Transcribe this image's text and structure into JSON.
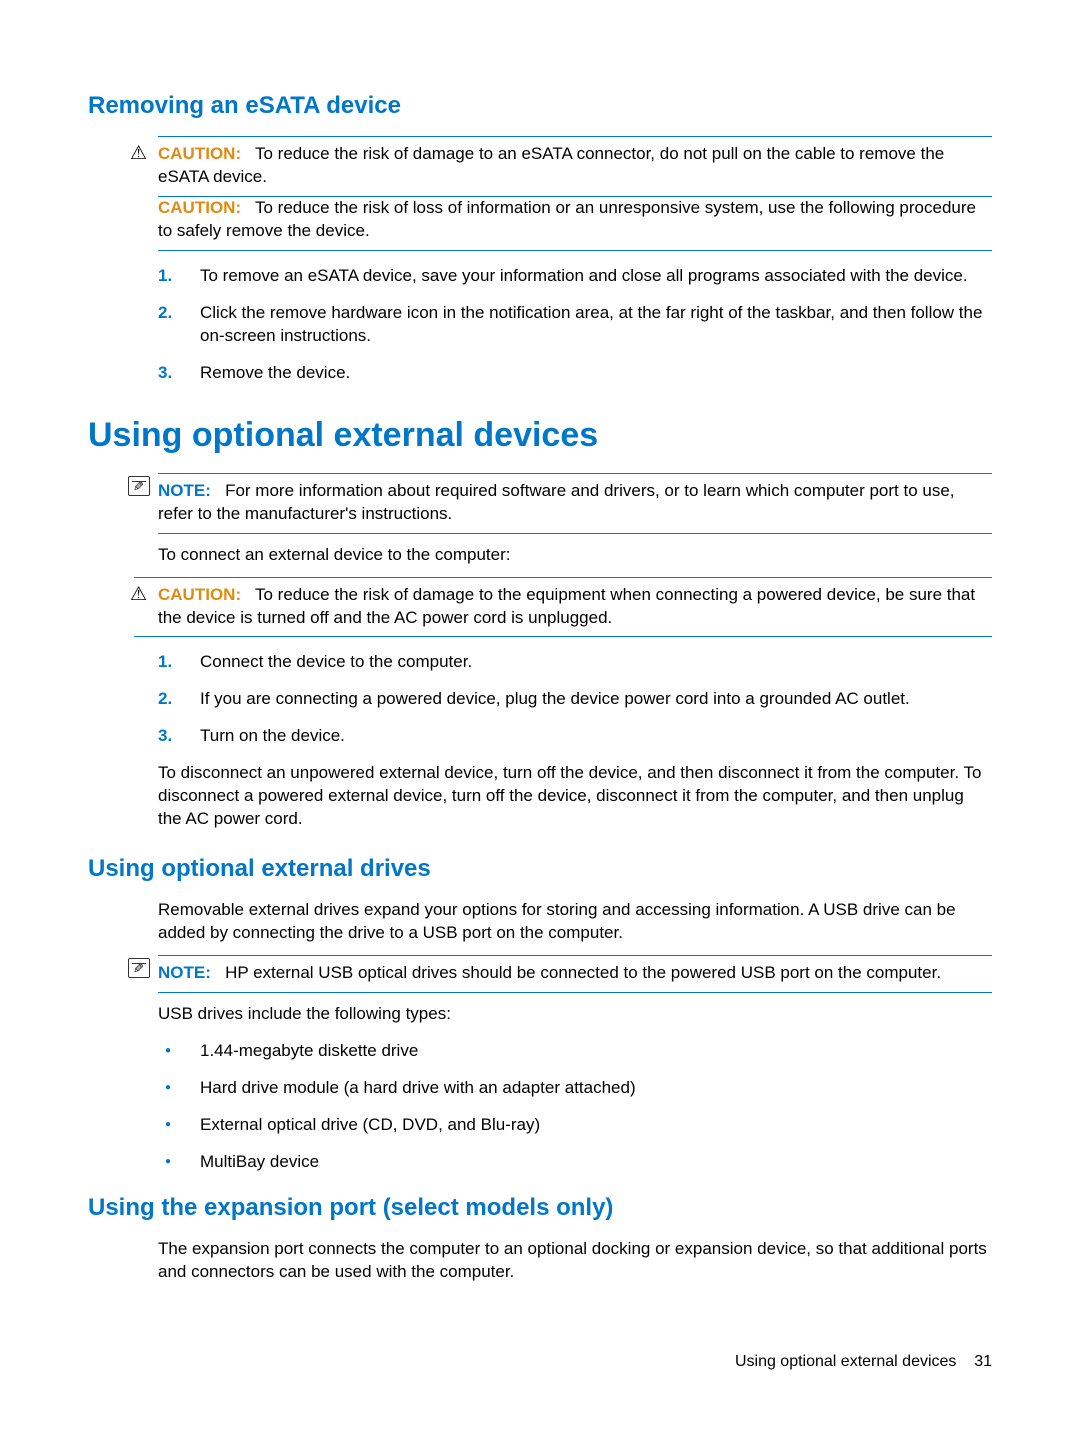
{
  "section1": {
    "title": "Removing an eSATA device",
    "caution1_label": "CAUTION:",
    "caution1_text": "To reduce the risk of damage to an eSATA connector, do not pull on the cable to remove the eSATA device.",
    "caution2_label": "CAUTION:",
    "caution2_text": "To reduce the risk of loss of information or an unresponsive system, use the following procedure to safely remove the device.",
    "steps": [
      "To remove an eSATA device, save your information and close all programs associated with the device.",
      "Click the remove hardware icon in the notification area, at the far right of the taskbar, and then follow the on-screen instructions.",
      "Remove the device."
    ]
  },
  "section2": {
    "title": "Using optional external devices",
    "note1_label": "NOTE:",
    "note1_text": "For more information about required software and drivers, or to learn which computer port to use, refer to the manufacturer's instructions.",
    "para1": "To connect an external device to the computer:",
    "caution_label": "CAUTION:",
    "caution_text": "To reduce the risk of damage to the equipment when connecting a powered device, be sure that the device is turned off and the AC power cord is unplugged.",
    "steps": [
      "Connect the device to the computer.",
      "If you are connecting a powered device, plug the device power cord into a grounded AC outlet.",
      "Turn on the device."
    ],
    "para2": "To disconnect an unpowered external device, turn off the device, and then disconnect it from the computer. To disconnect a powered external device, turn off the device, disconnect it from the computer, and then unplug the AC power cord."
  },
  "section3": {
    "title": "Using optional external drives",
    "para1": "Removable external drives expand your options for storing and accessing information. A USB drive can be added by connecting the drive to a USB port on the computer.",
    "note_label": "NOTE:",
    "note_text": "HP external USB optical drives should be connected to the powered USB port on the computer.",
    "para2": "USB drives include the following types:",
    "bullets": [
      "1.44-megabyte diskette drive",
      "Hard drive module (a hard drive with an adapter attached)",
      "External optical drive (CD, DVD, and Blu-ray)",
      "MultiBay device"
    ]
  },
  "section4": {
    "title": "Using the expansion port (select models only)",
    "para1": "The expansion port connects the computer to an optional docking or expansion device, so that additional ports and connectors can be used with the computer."
  },
  "footer": {
    "text": "Using optional external devices",
    "page": "31"
  }
}
